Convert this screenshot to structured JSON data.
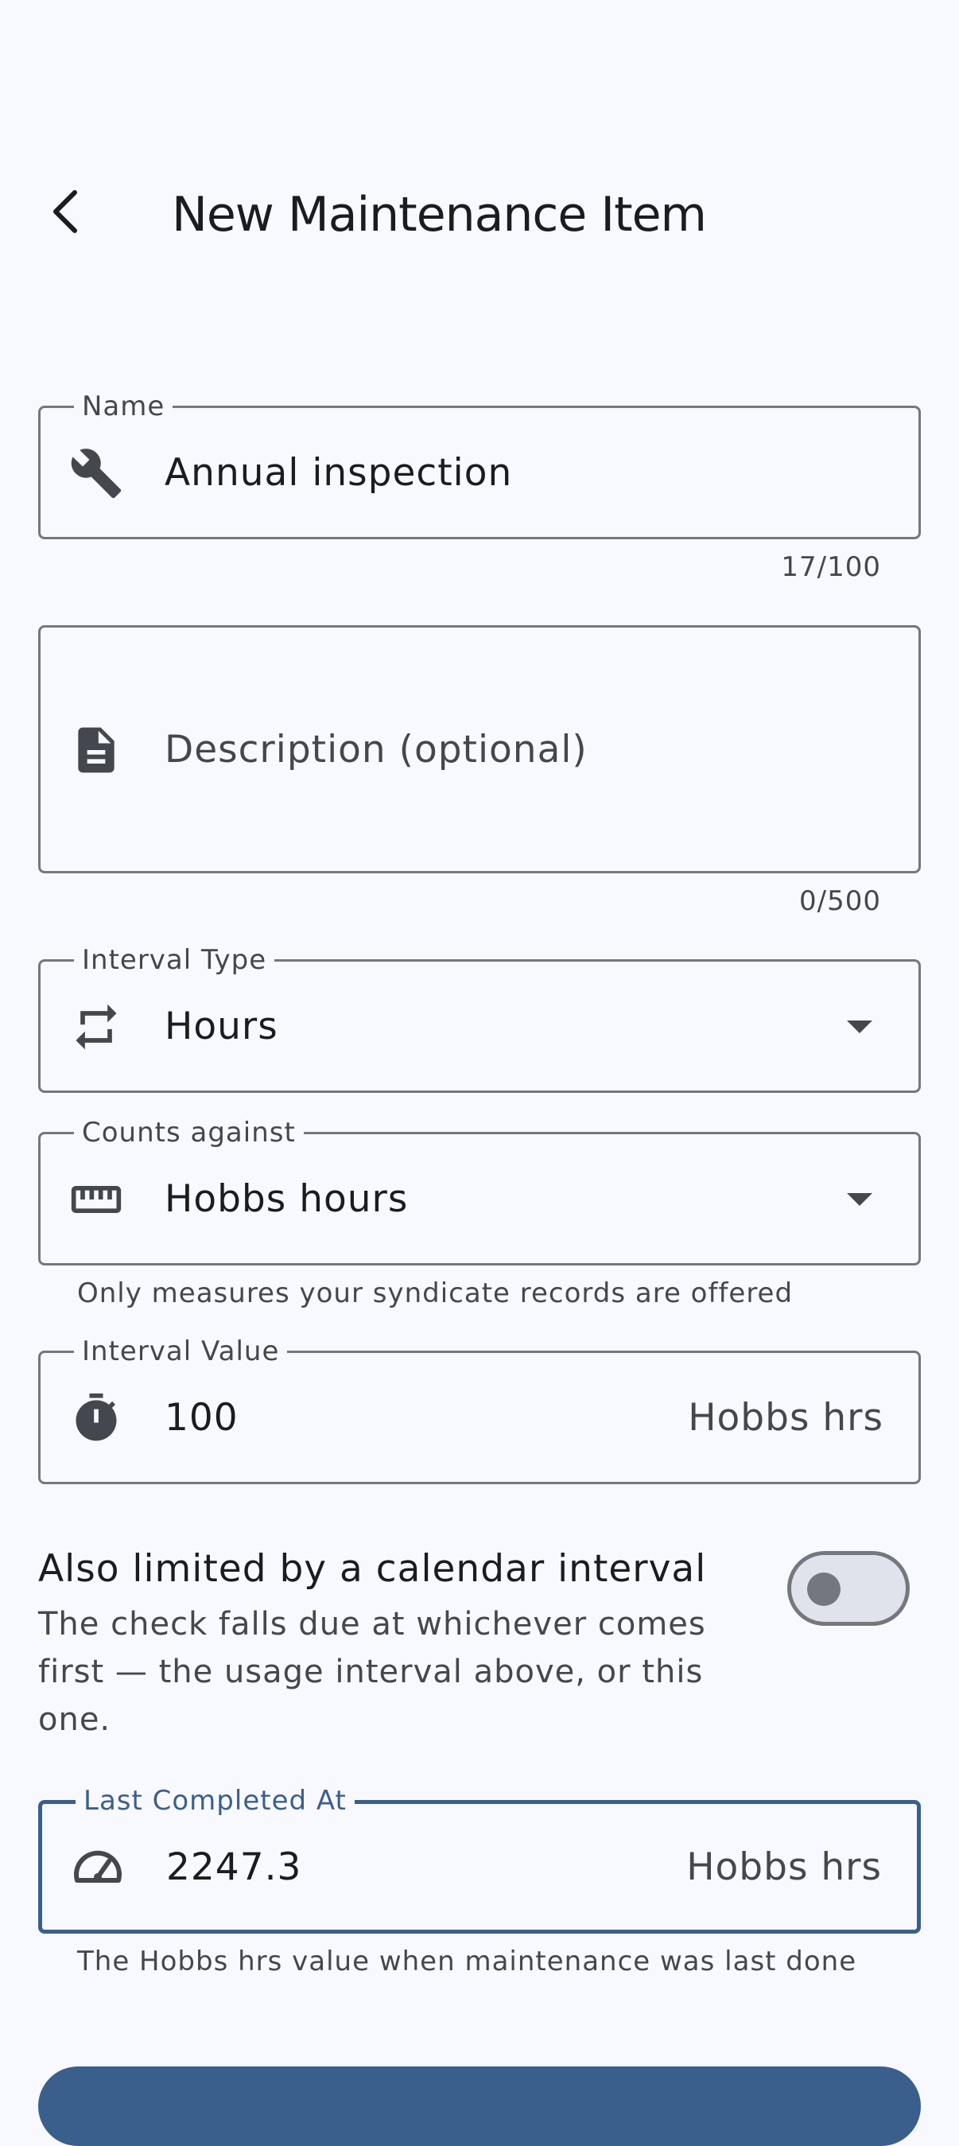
{
  "header": {
    "title": "New Maintenance Item"
  },
  "name_field": {
    "label": "Name",
    "value": "Annual inspection",
    "counter": "17/100"
  },
  "description_field": {
    "placeholder": "Description (optional)",
    "counter": "0/500"
  },
  "interval_type": {
    "label": "Interval Type",
    "value": "Hours"
  },
  "counts_against": {
    "label": "Counts against",
    "value": "Hobbs hours",
    "helper": "Only measures your syndicate records are offered"
  },
  "interval_value": {
    "label": "Interval Value",
    "value": "100",
    "suffix": "Hobbs hrs"
  },
  "calendar_toggle": {
    "title": "Also limited by a calendar interval",
    "subtitle": "The check falls due at whichever comes first — the usage interval above, or this one.",
    "checked": false
  },
  "last_completed": {
    "label": "Last Completed At",
    "value": "2247.3",
    "suffix": "Hobbs hrs",
    "helper": "The Hobbs hrs value when maintenance was last done"
  },
  "colors": {
    "primary": "#3b5f8c",
    "outline": "#75777f",
    "background": "#f8f9ff"
  },
  "icons": {
    "back": "arrow-back-icon",
    "name": "wrench-icon",
    "description": "document-icon",
    "interval_type": "repeat-icon",
    "counts_against": "ruler-icon",
    "interval_value": "timer-icon",
    "last_completed": "speedometer-icon"
  }
}
